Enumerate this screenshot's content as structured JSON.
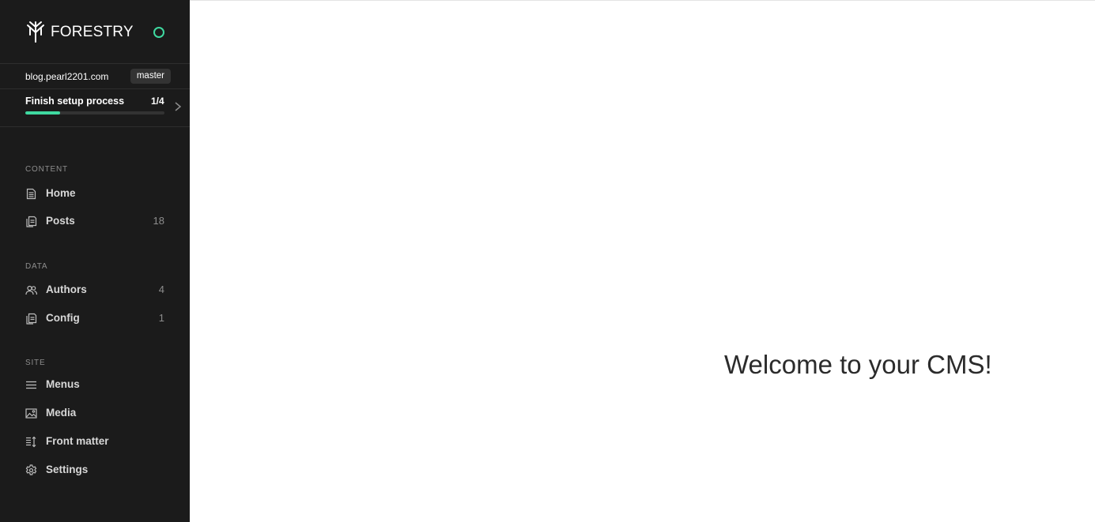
{
  "brand": {
    "name": "FORESTRY",
    "accent_color": "#3fd9a0"
  },
  "site": {
    "url": "blog.pearl2201.com",
    "branch": "master"
  },
  "setup": {
    "title": "Finish setup process",
    "count": "1/4",
    "progress": 0.25
  },
  "sections": {
    "content": {
      "label": "CONTENT",
      "items": [
        {
          "label": "Home",
          "icon": "document-icon",
          "count": ""
        },
        {
          "label": "Posts",
          "icon": "documents-icon",
          "count": "18"
        }
      ]
    },
    "data": {
      "label": "DATA",
      "items": [
        {
          "label": "Authors",
          "icon": "users-icon",
          "count": "4"
        },
        {
          "label": "Config",
          "icon": "documents-icon",
          "count": "1"
        }
      ]
    },
    "site": {
      "label": "SITE",
      "items": [
        {
          "label": "Menus",
          "icon": "menu-icon"
        },
        {
          "label": "Media",
          "icon": "image-icon"
        },
        {
          "label": "Front matter",
          "icon": "sort-list-icon"
        },
        {
          "label": "Settings",
          "icon": "gear-icon"
        }
      ]
    }
  },
  "main": {
    "welcome": "Welcome to your CMS!"
  }
}
